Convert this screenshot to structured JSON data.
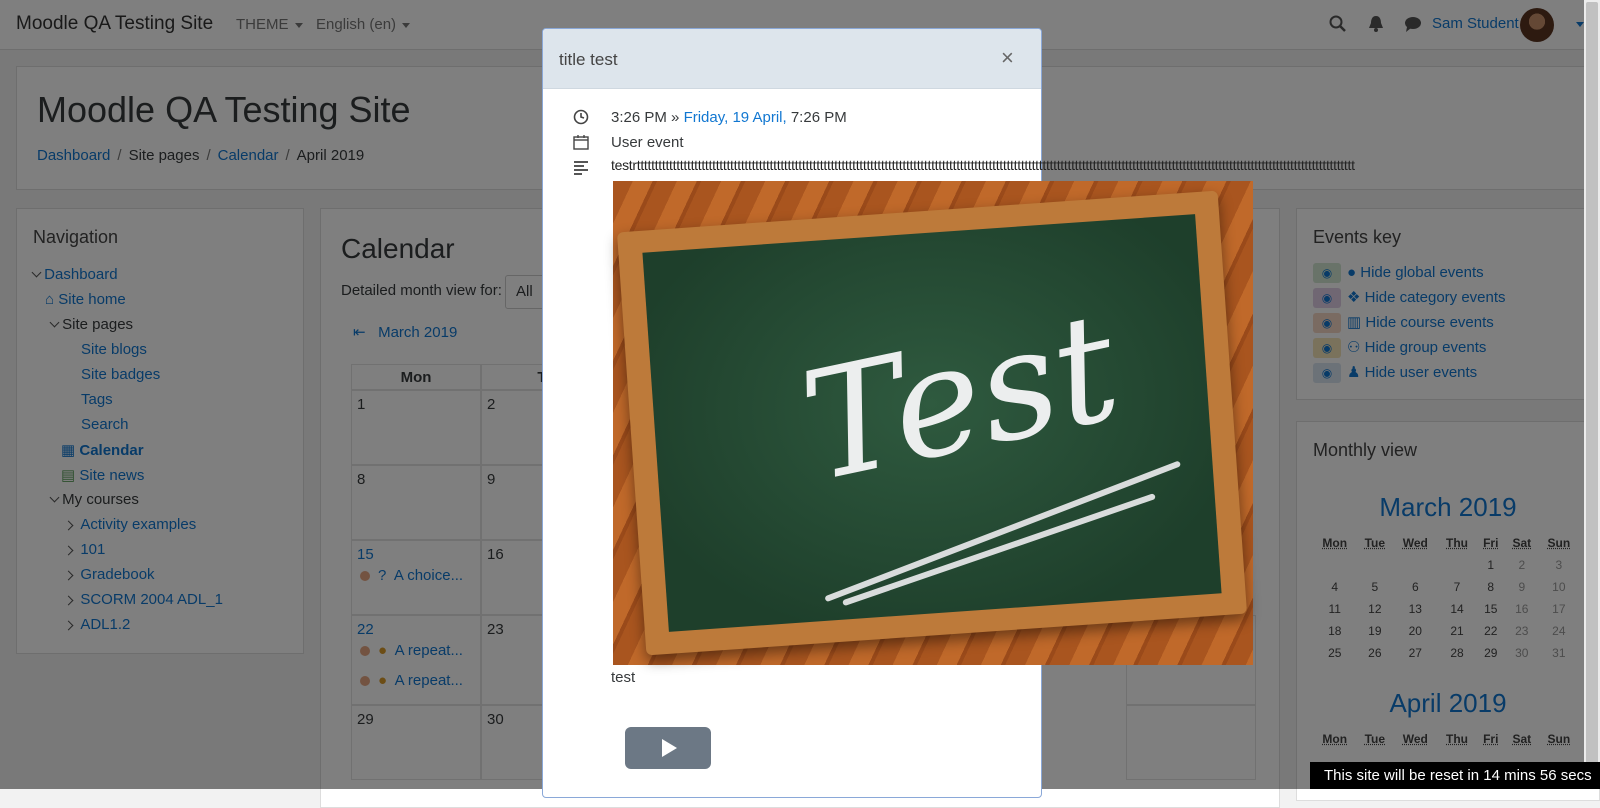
{
  "navbar": {
    "brand": "Moodle QA Testing Site",
    "theme_label": "THEME",
    "language_label": "English (en)",
    "user_name": "Sam Student"
  },
  "header": {
    "title": "Moodle QA Testing Site",
    "breadcrumb": [
      "Dashboard",
      "Site pages",
      "Calendar",
      "April 2019"
    ]
  },
  "navigation": {
    "title": "Navigation",
    "items": [
      {
        "label": "Dashboard"
      },
      {
        "label": "Site home"
      },
      {
        "label": "Site pages"
      },
      {
        "label": "Site blogs"
      },
      {
        "label": "Site badges"
      },
      {
        "label": "Tags"
      },
      {
        "label": "Search"
      },
      {
        "label": "Calendar"
      },
      {
        "label": "Site news"
      },
      {
        "label": "My courses"
      },
      {
        "label": "Activity examples"
      },
      {
        "label": "101"
      },
      {
        "label": "Gradebook"
      },
      {
        "label": "SCORM 2004 ADL_1"
      },
      {
        "label": "ADL1.2"
      }
    ]
  },
  "calendar": {
    "title": "Calendar",
    "detail_label": "Detailed month view for:",
    "detail_select": "All",
    "prev_month": "March 2019",
    "col_headers": [
      "Mon",
      "Tu"
    ],
    "days": [
      "1",
      "2",
      "8",
      "9",
      "15",
      "16",
      "22",
      "23",
      "29",
      "30"
    ],
    "events": [
      "A choice...",
      "A repeat...",
      "A repeat..."
    ]
  },
  "events_key": {
    "title": "Events key",
    "items": [
      {
        "label": "Hide global events",
        "color": "#d2e7d2"
      },
      {
        "label": "Hide category events",
        "color": "#e1cfe7"
      },
      {
        "label": "Hide course events",
        "color": "#f5d6c4"
      },
      {
        "label": "Hide group events",
        "color": "#f5e4b8"
      },
      {
        "label": "Hide user events",
        "color": "#d8e4f0"
      }
    ]
  },
  "monthly_view": {
    "title": "Monthly view",
    "months": [
      {
        "name": "March 2019",
        "headers": [
          "Mon",
          "Tue",
          "Wed",
          "Thu",
          "Fri",
          "Sat",
          "Sun"
        ],
        "weeks": [
          [
            "",
            "",
            "",
            "",
            "1",
            "2",
            "3"
          ],
          [
            "4",
            "5",
            "6",
            "7",
            "8",
            "9",
            "10"
          ],
          [
            "11",
            "12",
            "13",
            "14",
            "15",
            "16",
            "17"
          ],
          [
            "18",
            "19",
            "20",
            "21",
            "22",
            "23",
            "24"
          ],
          [
            "25",
            "26",
            "27",
            "28",
            "29",
            "30",
            "31"
          ]
        ]
      },
      {
        "name": "April 2019",
        "headers": [
          "Mon",
          "Tue",
          "Wed",
          "Thu",
          "Fri",
          "Sat",
          "Sun"
        ],
        "weeks": []
      }
    ]
  },
  "modal": {
    "title": "title test",
    "time_start": "3:26 PM",
    "time_sep": "»",
    "time_end_link": "Friday, 19 April,",
    "time_end": "7:26 PM",
    "event_type": "User event",
    "description": "testrtttttttttttttttttttttttttttttttttttttttttttttttttttttttttttttttttttttttttttttttttttttttttttttttttttttttttttttttttttttttttttttttttttttttttttttttttttttttttttttttttttttttttttttttttttttttttttttttttttttttt",
    "image_text": "Test",
    "image_caption": "test",
    "close_glyph": "×",
    "play_icon": "play-icon"
  },
  "reset_banner": "This site will be reset in 14 mins 56 secs"
}
